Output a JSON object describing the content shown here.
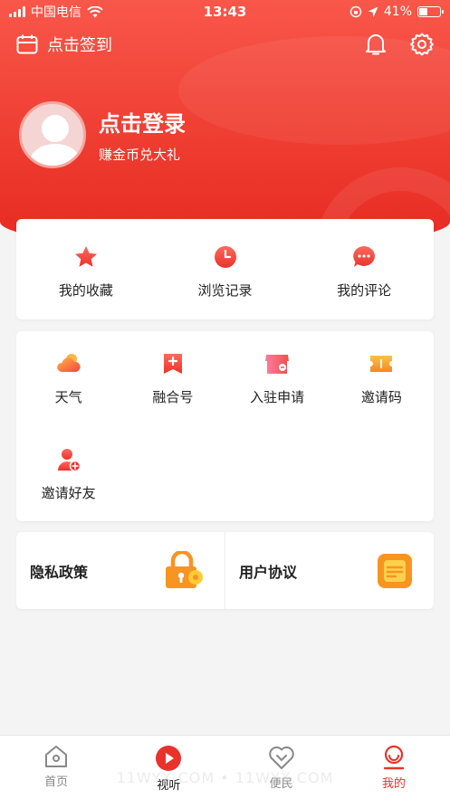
{
  "status_bar": {
    "carrier": "中国电信",
    "time": "13:43",
    "battery": "41%",
    "battery_level": 0.41
  },
  "header": {
    "sign_in_label": "点击签到",
    "login_title": "点击登录",
    "login_subtitle": "赚金币兑大礼"
  },
  "quick_actions": [
    {
      "label": "我的收藏",
      "icon": "star-icon",
      "color": "#f2463c"
    },
    {
      "label": "浏览记录",
      "icon": "clock-icon",
      "color": "#f0524a"
    },
    {
      "label": "我的评论",
      "icon": "comment-icon",
      "color": "#f0524a"
    }
  ],
  "services": [
    {
      "label": "天气",
      "icon": "weather-icon"
    },
    {
      "label": "融合号",
      "icon": "bookmark-plus-icon"
    },
    {
      "label": "入驻申请",
      "icon": "store-icon"
    },
    {
      "label": "邀请码",
      "icon": "ticket-icon"
    },
    {
      "label": "邀请好友",
      "icon": "invite-friend-icon"
    }
  ],
  "links": {
    "privacy": "隐私政策",
    "agreement": "用户协议"
  },
  "tabs": [
    {
      "label": "首页",
      "icon": "home-icon"
    },
    {
      "label": "视听",
      "icon": "play-icon"
    },
    {
      "label": "便民",
      "icon": "heart-icon"
    },
    {
      "label": "我的",
      "icon": "profile-icon"
    }
  ],
  "watermark": "11WYX.COM • 11WYX.COM",
  "colors": {
    "brand_red": "#e8332b",
    "orange": "#f89422"
  }
}
